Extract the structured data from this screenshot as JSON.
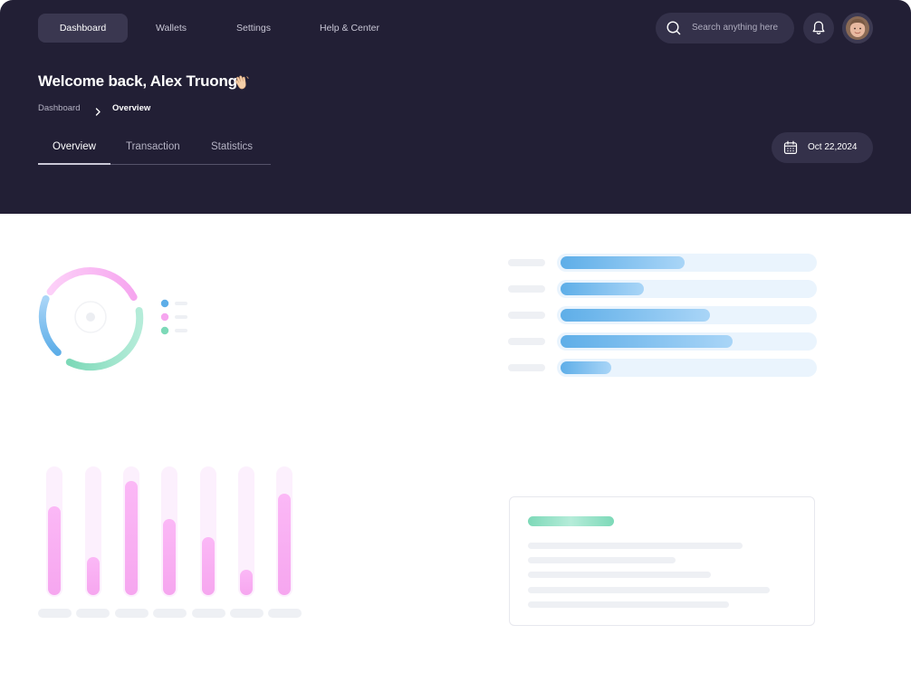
{
  "nav": {
    "tabs": [
      {
        "label": "Dashboard"
      },
      {
        "label": "Wallets"
      },
      {
        "label": "Settings"
      },
      {
        "label": "Help & Center"
      }
    ],
    "active_tab": "Dashboard"
  },
  "search": {
    "placeholder": "Search anything here"
  },
  "header": {
    "welcome": "Welcome back, Alex Truong",
    "breadcrumb": [
      "Dashboard",
      "Overview"
    ],
    "date": "Oct 22,2024"
  },
  "subtabs": [
    {
      "label": "Overview"
    },
    {
      "label": "Transaction"
    },
    {
      "label": "Statistics"
    }
  ],
  "colors": {
    "header_bg": "#221f35",
    "blue_accent": "#5eaee8",
    "pink_accent": "#f6a6ef",
    "green_accent": "#7dd9b8"
  },
  "widgets": {
    "progress_bars": [
      0.49,
      0.33,
      0.59,
      0.68,
      0.2
    ],
    "column_levels": [
      0.7,
      0.3,
      0.9,
      0.6,
      0.46,
      0.2,
      0.8
    ],
    "donut_legend": [
      "blue",
      "pink",
      "green"
    ]
  }
}
